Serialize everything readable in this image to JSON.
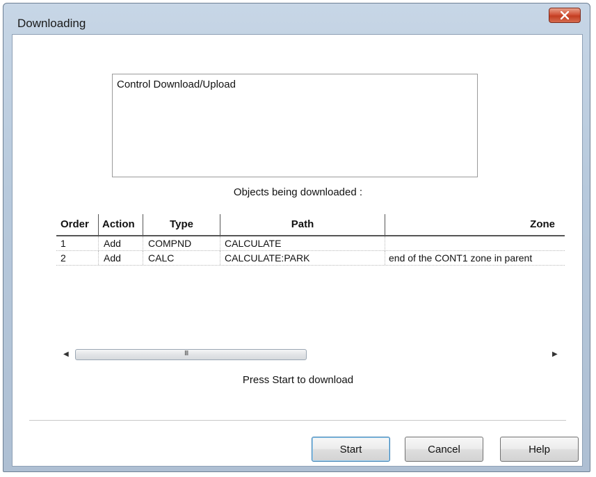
{
  "window": {
    "title": "Downloading"
  },
  "info_box": {
    "text": "Control Download/Upload"
  },
  "objects_label": "Objects being downloaded :",
  "table": {
    "columns": [
      "Order",
      "Action",
      "Type",
      "Path",
      "Zone"
    ],
    "rows": [
      {
        "order": "1",
        "action": "Add",
        "type": "COMPND",
        "path": "CALCULATE",
        "zone": ""
      },
      {
        "order": "2",
        "action": "Add",
        "type": "CALC",
        "path": "CALCULATE:PARK",
        "zone": "end of the CONT1 zone in parent"
      }
    ]
  },
  "scrollbar": {
    "grip": "III"
  },
  "status_text": "Press Start to download",
  "buttons": {
    "start": "Start",
    "cancel": "Cancel",
    "help": "Help"
  },
  "colors": {
    "close_button": "#c33d21",
    "frame": "#b7c9dc"
  },
  "icons": {
    "close": "close-icon",
    "scroll_left": "scroll-left-arrow-icon",
    "scroll_right": "scroll-right-arrow-icon"
  }
}
